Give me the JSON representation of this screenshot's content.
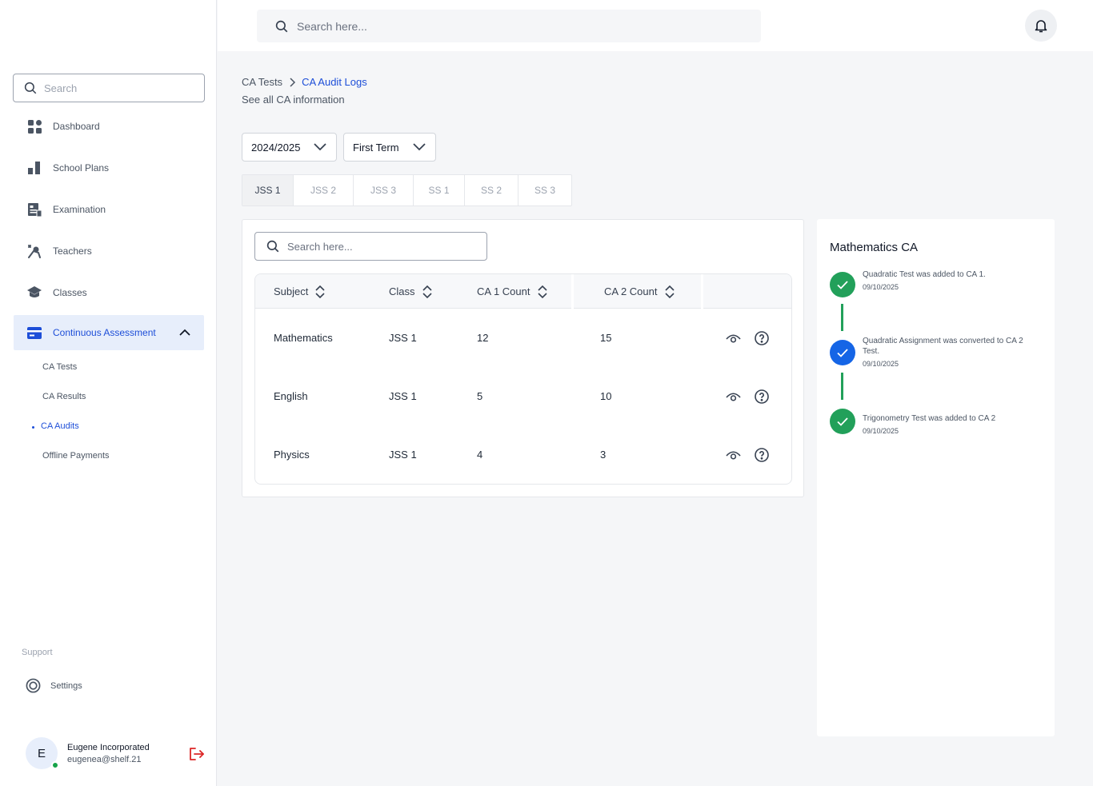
{
  "sidebar": {
    "search_placeholder": "Search",
    "items": [
      {
        "label": "Dashboard",
        "icon": "grid-icon"
      },
      {
        "label": "School Plans",
        "icon": "bar-chart-icon"
      },
      {
        "label": "Examination",
        "icon": "document-icon"
      },
      {
        "label": "Teachers",
        "icon": "teacher-icon"
      },
      {
        "label": "Classes",
        "icon": "graduation-cap-icon"
      },
      {
        "label": "Continuous Assessment",
        "icon": "card-icon"
      }
    ],
    "subitems": [
      {
        "label": "CA Tests"
      },
      {
        "label": "CA Results"
      },
      {
        "label": "CA Audits"
      },
      {
        "label": "Offline Payments"
      }
    ],
    "support_label": "Support",
    "settings_label": "Settings",
    "user": {
      "initial": "E",
      "name": "Eugene Incorporated",
      "email": "eugenea@shelf.21"
    }
  },
  "topbar": {
    "search_placeholder": "Search here..."
  },
  "breadcrumb": {
    "parent": "CA Tests",
    "current": "CA Audit Logs",
    "subtitle": "See all CA information"
  },
  "filters": {
    "session": "2024/2025",
    "term": "First Term"
  },
  "tabs": [
    "JSS 1",
    "JSS 2",
    "JSS 3",
    "SS 1",
    "SS 2",
    "SS 3"
  ],
  "table": {
    "search_placeholder": "Search here...",
    "columns": [
      "Subject",
      "Class",
      "CA 1 Count",
      "CA 2 Count"
    ],
    "rows": [
      {
        "subject": "Mathematics",
        "class": "JSS 1",
        "ca1": "12",
        "ca2": "15"
      },
      {
        "subject": "English",
        "class": "JSS 1",
        "ca1": "5",
        "ca2": "10"
      },
      {
        "subject": "Physics",
        "class": "JSS 1",
        "ca1": "4",
        "ca2": "3"
      }
    ]
  },
  "panel": {
    "title": "Mathematics CA",
    "events": [
      {
        "text": "Quadratic Test was added to CA 1.",
        "date": "09/10/2025",
        "color": "#22a05a"
      },
      {
        "text": "Quadratic Assignment was converted to CA 2 Test.",
        "date": "09/10/2025",
        "color": "#1565e6"
      },
      {
        "text": "Trigonometry Test was added to CA 2",
        "date": "09/10/2025",
        "color": "#22a05a"
      }
    ]
  },
  "colors": {
    "accent": "#1d4ed8",
    "success": "#22a05a",
    "logout": "#dc2626"
  }
}
